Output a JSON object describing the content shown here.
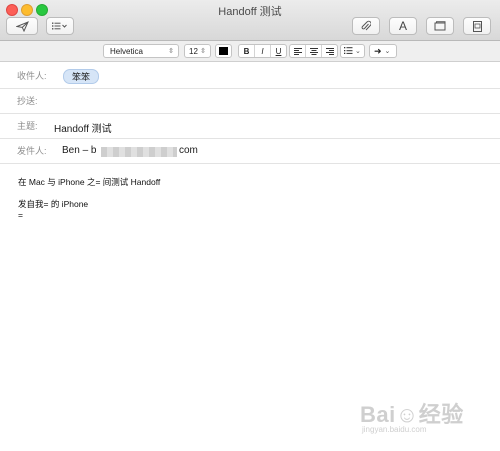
{
  "window": {
    "title": "Handoff 测试",
    "controls": [
      "close",
      "minimize",
      "maximize"
    ]
  },
  "toolbar": {
    "left_buttons": [
      {
        "name": "send-button",
        "icon": "paper-plane-icon"
      },
      {
        "name": "header-fields-button",
        "icon": "list-icon"
      }
    ],
    "right_buttons": [
      {
        "name": "attach-button",
        "icon": "paperclip-icon"
      },
      {
        "name": "fonts-button",
        "label": "A"
      },
      {
        "name": "stationery-button",
        "icon": "window-icon"
      },
      {
        "name": "photo-browser-button",
        "icon": "photo-icon"
      }
    ]
  },
  "format_bar": {
    "font": "Helvetica",
    "size": "12",
    "color": "#000000",
    "styles": [
      "B",
      "I",
      "U"
    ],
    "alignment": [
      "left",
      "center",
      "right"
    ]
  },
  "fields": {
    "to_label": "收件人:",
    "to_value": "笨笨",
    "cc_label": "抄送:",
    "subject_label": "主题:",
    "subject_value": "Handoff 测试",
    "from_label": "发件人:",
    "from_prefix": "Ben – b",
    "from_suffix": "com"
  },
  "body": {
    "line1": "在 Mac 与 iPhone 之= 间测试 Handoff",
    "line2": "发自我= 的 iPhone",
    "line3": "="
  },
  "watermark": {
    "logo": "Bai☺经验",
    "site": "jingyan.baidu.com"
  }
}
